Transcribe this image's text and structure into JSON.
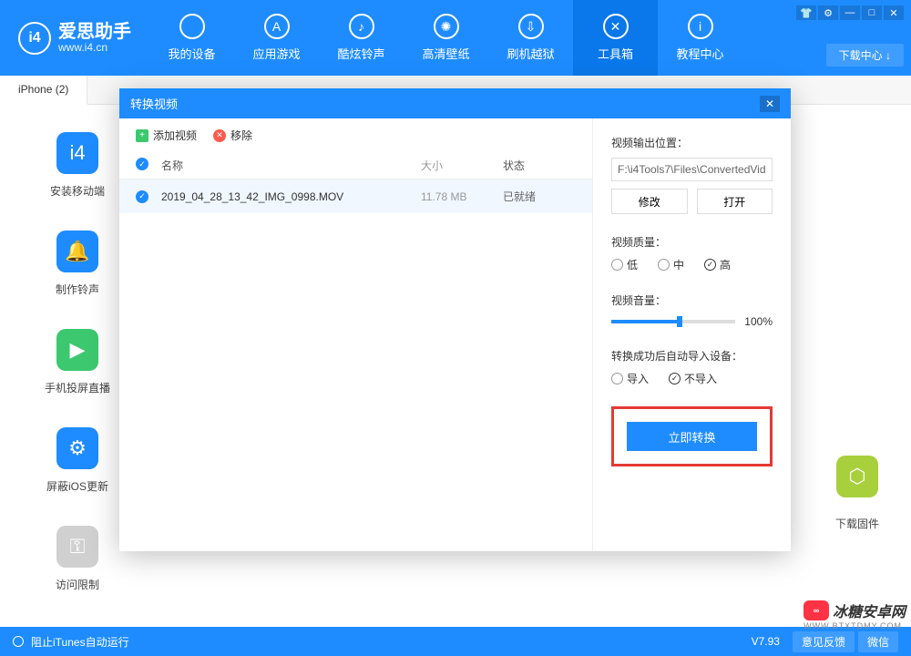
{
  "header": {
    "logo_badge": "i4",
    "title": "爱思助手",
    "subtitle": "www.i4.cn",
    "download_center": "下载中心 ↓",
    "nav": [
      {
        "label": "我的设备"
      },
      {
        "label": "应用游戏"
      },
      {
        "label": "酷炫铃声"
      },
      {
        "label": "高清壁纸"
      },
      {
        "label": "刷机越狱"
      },
      {
        "label": "工具箱"
      },
      {
        "label": "教程中心"
      }
    ]
  },
  "tab": {
    "label": "iPhone (2)"
  },
  "sidebar": [
    {
      "label": "安装移动端"
    },
    {
      "label": "制作铃声"
    },
    {
      "label": "手机投屏直播"
    },
    {
      "label": "屏蔽iOS更新"
    },
    {
      "label": "访问限制"
    }
  ],
  "right_tool": {
    "label": "下载固件"
  },
  "modal": {
    "title": "转换视频",
    "toolbar": {
      "add": "添加视频",
      "remove": "移除"
    },
    "columns": {
      "name": "名称",
      "size": "大小",
      "status": "状态"
    },
    "row": {
      "name": "2019_04_28_13_42_IMG_0998.MOV",
      "size": "11.78 MB",
      "status": "已就绪"
    },
    "output": {
      "label": "视频输出位置：",
      "path": "F:\\i4Tools7\\Files\\ConvertedVid",
      "modify": "修改",
      "open": "打开"
    },
    "quality": {
      "label": "视频质量：",
      "low": "低",
      "mid": "中",
      "high": "高"
    },
    "volume": {
      "label": "视频音量：",
      "value": "100%"
    },
    "autoimport": {
      "label": "转换成功后自动导入设备：",
      "yes": "导入",
      "no": "不导入"
    },
    "convert": "立即转换"
  },
  "footer": {
    "itunes": "阻止iTunes自动运行",
    "version": "V7.93",
    "feedback": "意见反馈",
    "wechat": "微信"
  },
  "watermark": {
    "text": "冰糖安卓网",
    "sub": "WWW.BTXTDMY.COM"
  }
}
